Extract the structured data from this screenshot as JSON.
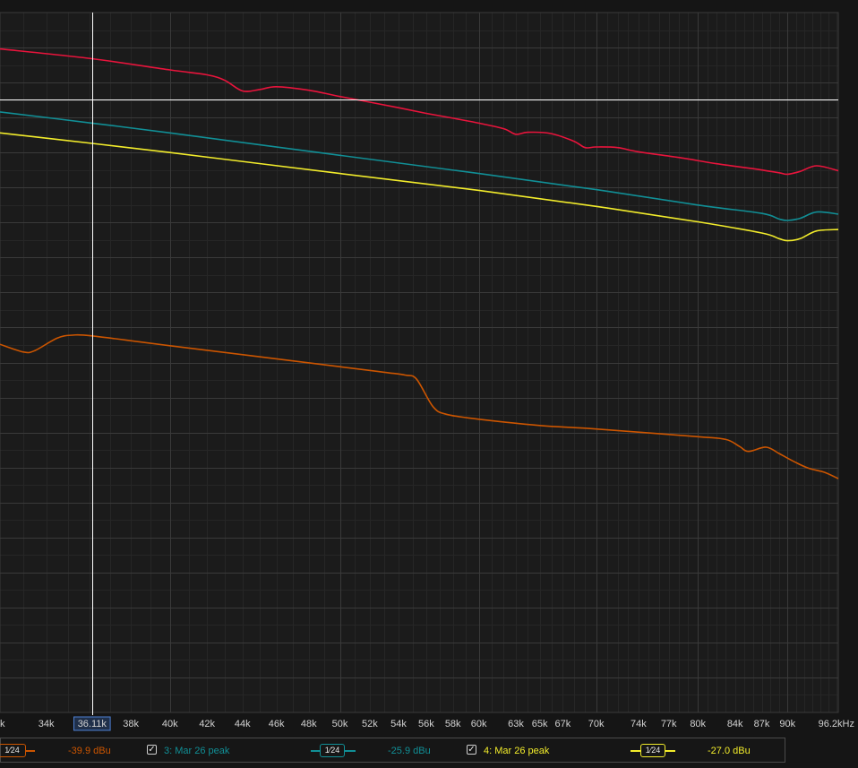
{
  "cursor": {
    "frequency_label": "36.11k"
  },
  "colors": {
    "background": "#151515",
    "grid_major": "#3a3a3a",
    "grid_minor": "#262626",
    "trace_1": "#cc5500",
    "trace_2": "#e8143c",
    "trace_3": "#118f96",
    "trace_4": "#f2ec2b",
    "cursor": "#ffffff"
  },
  "legend": [
    {
      "id": "1",
      "label": "",
      "smoothing": "1⁄24",
      "value": "-39.9 dBu",
      "color": "#cc5500"
    },
    {
      "id": "3",
      "label": "3: Mar 26 peak",
      "checked": true,
      "smoothing": "1⁄24",
      "value": "-25.9 dBu",
      "color": "#118f96"
    },
    {
      "id": "4",
      "label": "4: Mar 26 peak",
      "checked": true,
      "smoothing": "1⁄24",
      "value": "-27.0 dBu",
      "color": "#f2ec2b"
    }
  ],
  "chart_data": {
    "type": "line",
    "x_scale": "log",
    "xlim": [
      32000,
      96200
    ],
    "ylim": [
      0,
      100
    ],
    "y_units": "relative (no y-axis labels shown)",
    "grid": true,
    "x_tick_labels": [
      {
        "label": "k",
        "value": 32000
      },
      {
        "label": "34k",
        "value": 34000
      },
      {
        "label": "36.11k",
        "value": 36110,
        "highlighted": true
      },
      {
        "label": "38k",
        "value": 38000
      },
      {
        "label": "40k",
        "value": 40000
      },
      {
        "label": "42k",
        "value": 42000
      },
      {
        "label": "44k",
        "value": 44000
      },
      {
        "label": "46k",
        "value": 46000
      },
      {
        "label": "48k",
        "value": 48000
      },
      {
        "label": "50k",
        "value": 50000
      },
      {
        "label": "52k",
        "value": 52000
      },
      {
        "label": "54k",
        "value": 54000
      },
      {
        "label": "56k",
        "value": 56000
      },
      {
        "label": "58k",
        "value": 58000
      },
      {
        "label": "60k",
        "value": 60000
      },
      {
        "label": "63k",
        "value": 63000
      },
      {
        "label": "65k",
        "value": 65000
      },
      {
        "label": "67k",
        "value": 67000
      },
      {
        "label": "70k",
        "value": 70000
      },
      {
        "label": "74k",
        "value": 74000
      },
      {
        "label": "77k",
        "value": 77000
      },
      {
        "label": "80k",
        "value": 80000
      },
      {
        "label": "84k",
        "value": 84000
      },
      {
        "label": "87k",
        "value": 87000
      },
      {
        "label": "90k",
        "value": 90000
      },
      {
        "label": "96.2kHz",
        "value": 96200
      }
    ],
    "series": [
      {
        "id": "red",
        "color": "#e8143c",
        "points": [
          [
            32000,
            94.8
          ],
          [
            36110,
            93.4
          ],
          [
            40000,
            91.8
          ],
          [
            42000,
            91.1
          ],
          [
            43000,
            90.3
          ],
          [
            44000,
            88.8
          ],
          [
            45000,
            89.0
          ],
          [
            46000,
            89.4
          ],
          [
            48000,
            88.9
          ],
          [
            50000,
            88.0
          ],
          [
            52000,
            87.2
          ],
          [
            54000,
            86.4
          ],
          [
            56000,
            85.6
          ],
          [
            58000,
            84.9
          ],
          [
            60000,
            84.2
          ],
          [
            62000,
            83.4
          ],
          [
            63000,
            82.6
          ],
          [
            64000,
            82.9
          ],
          [
            66000,
            82.7
          ],
          [
            68000,
            81.6
          ],
          [
            69000,
            80.7
          ],
          [
            70000,
            80.8
          ],
          [
            72000,
            80.7
          ],
          [
            74000,
            80.1
          ],
          [
            78000,
            79.3
          ],
          [
            82000,
            78.4
          ],
          [
            86000,
            77.7
          ],
          [
            89000,
            77.1
          ],
          [
            90000,
            76.9
          ],
          [
            91500,
            77.3
          ],
          [
            93500,
            78.1
          ],
          [
            96200,
            77.4
          ]
        ]
      },
      {
        "id": "teal",
        "color": "#118f96",
        "points": [
          [
            32000,
            85.8
          ],
          [
            36110,
            84.2
          ],
          [
            40000,
            82.8
          ],
          [
            50000,
            79.6
          ],
          [
            60000,
            77.0
          ],
          [
            70000,
            74.7
          ],
          [
            80000,
            72.5
          ],
          [
            87000,
            71.3
          ],
          [
            89000,
            70.5
          ],
          [
            90000,
            70.3
          ],
          [
            91500,
            70.6
          ],
          [
            93500,
            71.5
          ],
          [
            96200,
            71.2
          ]
        ]
      },
      {
        "id": "yellow",
        "color": "#f2ec2b",
        "points": [
          [
            32000,
            82.8
          ],
          [
            36110,
            81.3
          ],
          [
            40000,
            80.0
          ],
          [
            50000,
            77.0
          ],
          [
            60000,
            74.6
          ],
          [
            70000,
            72.3
          ],
          [
            80000,
            70.1
          ],
          [
            87000,
            68.5
          ],
          [
            89000,
            67.7
          ],
          [
            90000,
            67.4
          ],
          [
            91500,
            67.7
          ],
          [
            93500,
            68.8
          ],
          [
            96200,
            69.0
          ]
        ]
      },
      {
        "id": "orange",
        "color": "#cc5500",
        "points": [
          [
            32000,
            52.6
          ],
          [
            33000,
            51.5
          ],
          [
            33500,
            51.7
          ],
          [
            34500,
            53.5
          ],
          [
            35200,
            53.9
          ],
          [
            36110,
            53.8
          ],
          [
            40000,
            52.4
          ],
          [
            50000,
            49.4
          ],
          [
            53000,
            48.6
          ],
          [
            54500,
            48.2
          ],
          [
            55300,
            47.6
          ],
          [
            56500,
            43.7
          ],
          [
            57500,
            42.6
          ],
          [
            60000,
            41.9
          ],
          [
            65000,
            41.0
          ],
          [
            70000,
            40.5
          ],
          [
            80000,
            39.4
          ],
          [
            83000,
            39.0
          ],
          [
            84500,
            38.0
          ],
          [
            85500,
            37.3
          ],
          [
            87500,
            37.9
          ],
          [
            89000,
            37.0
          ],
          [
            90500,
            36.0
          ],
          [
            92500,
            34.9
          ],
          [
            94500,
            34.3
          ],
          [
            96200,
            33.4
          ]
        ]
      }
    ]
  }
}
